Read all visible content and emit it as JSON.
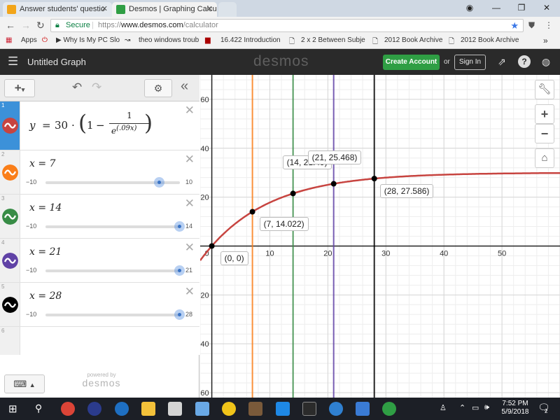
{
  "browser": {
    "tabs": [
      {
        "label": "Answer students' questio",
        "active": false
      },
      {
        "label": "Desmos | Graphing Calcul",
        "active": true
      }
    ],
    "secure_label": "Secure",
    "url_prefix": "https://",
    "url_domain": "www.desmos.com",
    "url_path": "/calculator",
    "bookmarks": [
      "Apps",
      "Why Is My PC Slo",
      "theo windows troub",
      "16.422 Introduction",
      "2 x 2 Between Subje",
      "2012 Book Archive",
      "2012 Book Archive"
    ],
    "more_bookmarks": "»"
  },
  "desmos": {
    "graph_title": "Untitled Graph",
    "logo": "desmos",
    "create_account": "Create Account",
    "or": "or",
    "sign_in": "Sign In",
    "powered_by": "powered by",
    "powered_logo": "desmos"
  },
  "expressions": [
    {
      "num": "1",
      "color": "#c74440",
      "type": "equation",
      "lhs": "y",
      "eq": "=",
      "coef": "30",
      "dot": "·",
      "one": "1",
      "minus": "−",
      "frac_num": "1",
      "frac_den_base": "e",
      "frac_den_exp": "(.09x)"
    },
    {
      "num": "2",
      "color": "#fa7e19",
      "type": "slider",
      "text": "x = 7",
      "min": "−10",
      "max": "10",
      "value": 7,
      "range": [
        -10,
        10
      ]
    },
    {
      "num": "3",
      "color": "#388c46",
      "type": "slider",
      "text": "x = 14",
      "min": "−10",
      "max": "14",
      "value": 14,
      "range": [
        -10,
        14
      ]
    },
    {
      "num": "4",
      "color": "#6042a6",
      "type": "slider",
      "text": "x = 21",
      "min": "−10",
      "max": "21",
      "value": 21,
      "range": [
        -10,
        21
      ]
    },
    {
      "num": "5",
      "color": "#000000",
      "type": "slider",
      "text": "x = 28",
      "min": "−10",
      "max": "28",
      "value": 28,
      "range": [
        -10,
        28
      ]
    },
    {
      "num": "6"
    }
  ],
  "chart_data": {
    "type": "line",
    "function": "y = 30·(1 − 1/e^(.09x))",
    "curve_color": "#c74440",
    "xlim": [
      -2,
      60
    ],
    "ylim": [
      -62,
      70
    ],
    "x_ticks": [
      10,
      20,
      30,
      40,
      50
    ],
    "y_ticks": [
      -60,
      -40,
      -20,
      20,
      40,
      60
    ],
    "origin_label": "0",
    "grid": true,
    "vertical_lines": [
      {
        "x": 7,
        "color": "#fa7e19"
      },
      {
        "x": 14,
        "color": "#388c46"
      },
      {
        "x": 21,
        "color": "#6042a6"
      },
      {
        "x": 28,
        "color": "#000000"
      }
    ],
    "points": [
      {
        "x": 0,
        "y": 0,
        "label": "(0, 0)"
      },
      {
        "x": 7,
        "y": 14.022,
        "label": "(7, 14.022)"
      },
      {
        "x": 14,
        "y": 21.49,
        "label": "(14, 21.49)"
      },
      {
        "x": 21,
        "y": 25.468,
        "label": "(21, 25.468)"
      },
      {
        "x": 28,
        "y": 27.586,
        "label": "(28, 27.586)"
      }
    ]
  },
  "taskbar": {
    "time": "7:52 PM",
    "date": "5/9/2018",
    "notifications": "2"
  }
}
